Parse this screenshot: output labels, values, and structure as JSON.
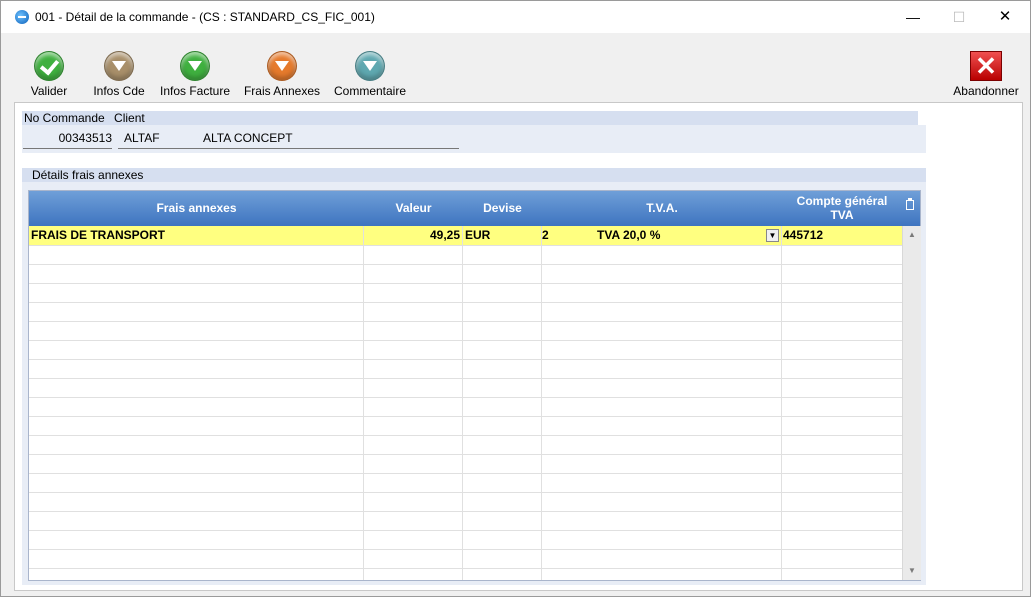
{
  "window": {
    "title": "001 - Détail de la commande - (CS : STANDARD_CS_FIC_001)",
    "minimize": "—",
    "maximize": "☐",
    "close": "✕"
  },
  "toolbar": {
    "buttons": [
      {
        "label": "Valider",
        "icon": "check-icon",
        "color": "#3fb03f"
      },
      {
        "label": "Infos Cde",
        "icon": "down-triangle-icon",
        "color": "#a88f6a"
      },
      {
        "label": "Infos Facture",
        "icon": "down-triangle-icon",
        "color": "#3fb03f"
      },
      {
        "label": "Frais Annexes",
        "icon": "down-triangle-icon",
        "color": "#e57a2c"
      },
      {
        "label": "Commentaire",
        "icon": "down-triangle-icon",
        "color": "#5fa8b0"
      }
    ],
    "cancel_label": "Abandonner",
    "cancel_color": "#d42020"
  },
  "order": {
    "order_no_label": "No Commande",
    "client_label": "Client",
    "order_no": "00343513",
    "client_code": "ALTAF",
    "client_name": "ALTA CONCEPT"
  },
  "details": {
    "section_title": "Détails frais annexes",
    "columns": [
      "Frais annexes",
      "Valeur",
      "Devise",
      "T.V.A.",
      "Compte général TVA"
    ],
    "column_lines": [
      "Compte général",
      "TVA"
    ],
    "rows": [
      {
        "frais": "FRAIS DE TRANSPORT",
        "valeur": "49,25",
        "devise": "EUR",
        "tva_code": "2",
        "tva_label": "TVA 20,0 %",
        "compte": "445712"
      }
    ],
    "selected_row_color": "#ffff80",
    "header_color": "#4a80c8"
  }
}
